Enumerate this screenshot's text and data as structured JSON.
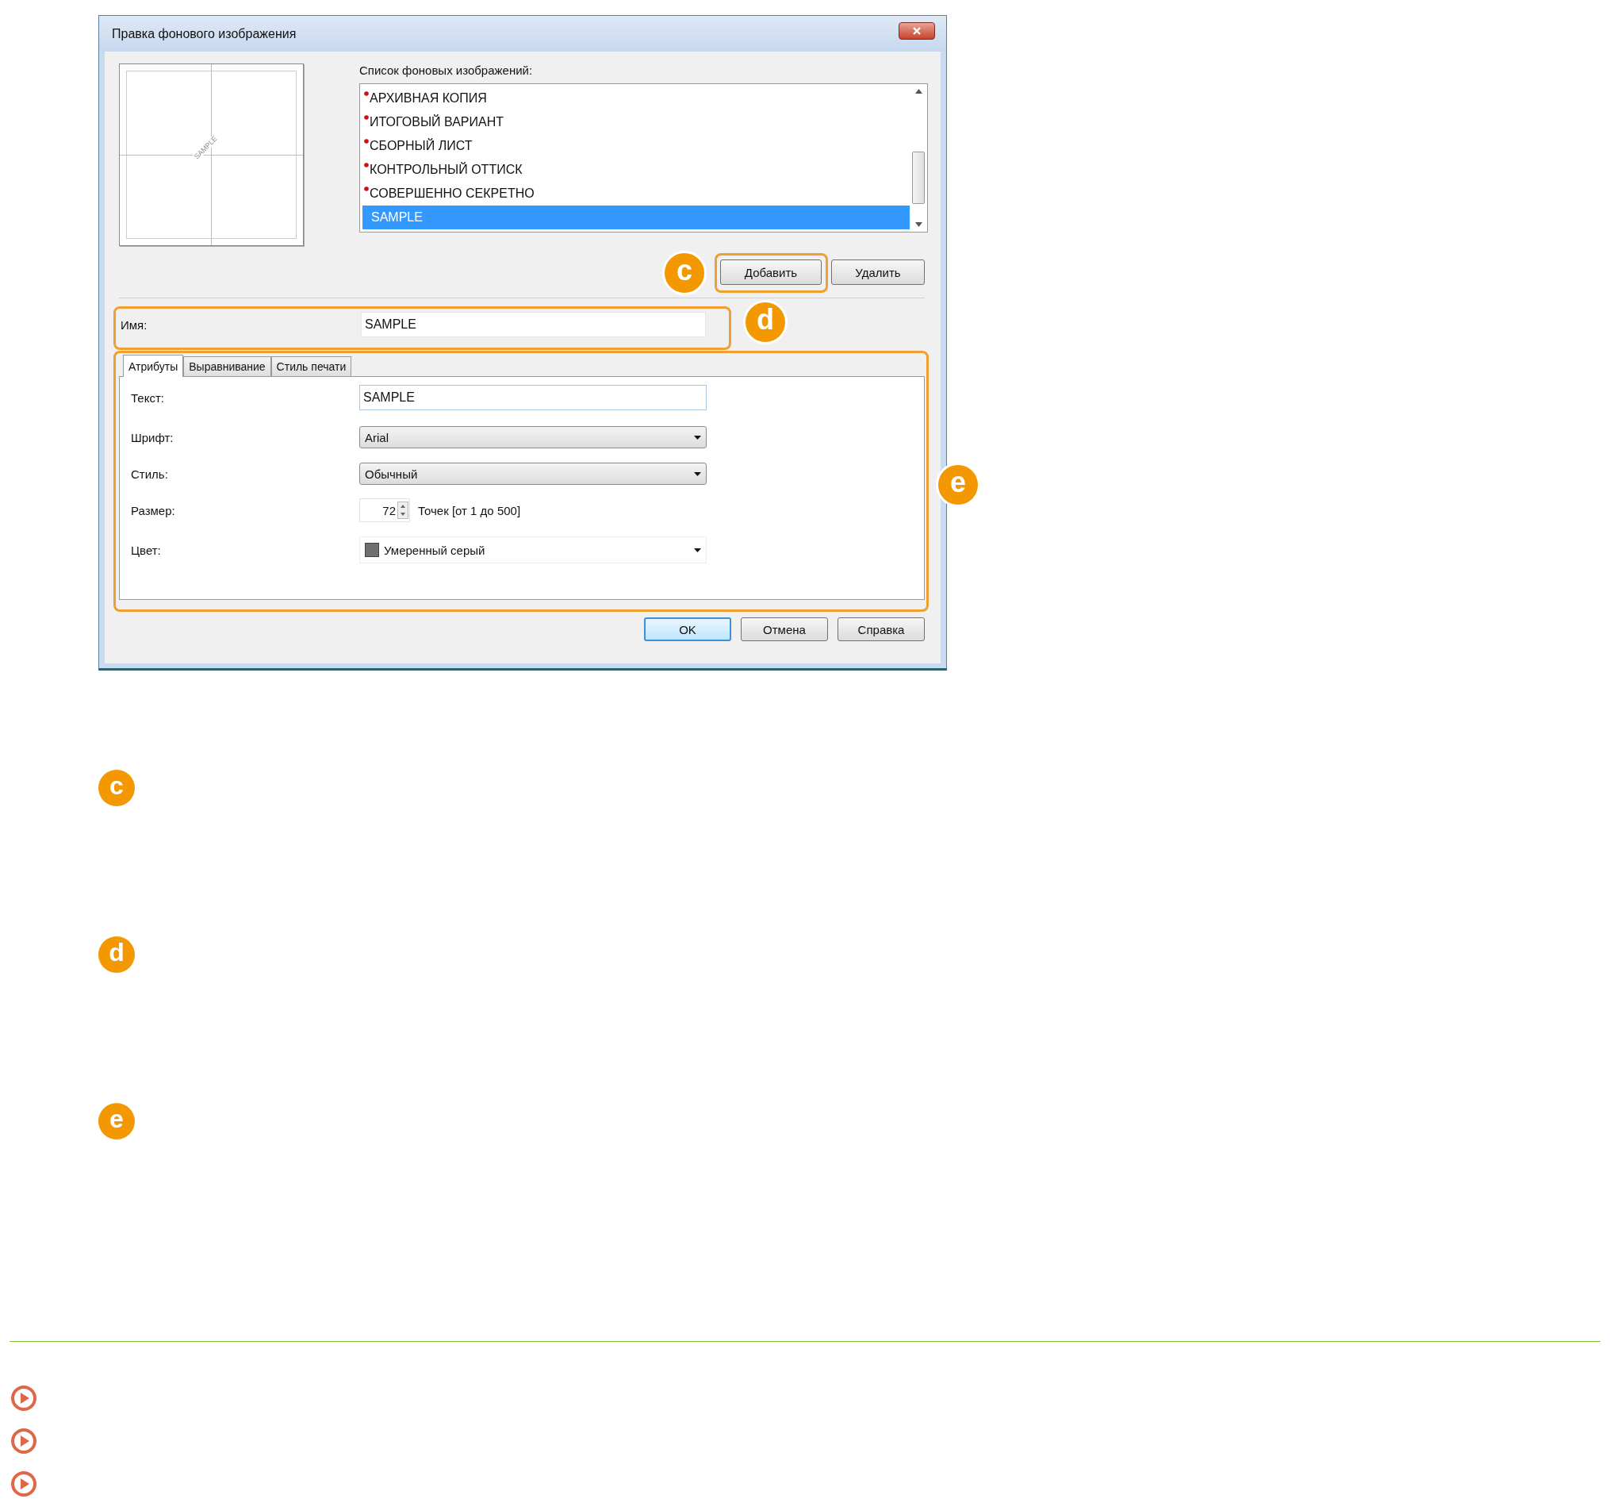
{
  "dialog": {
    "title": "Правка фонового изображения",
    "preview": {
      "sample_text": "SAMPLE"
    },
    "list_label": "Список фоновых изображений:",
    "list_items": [
      {
        "label": "АРХИВНАЯ КОПИЯ",
        "marked": true,
        "selected": false
      },
      {
        "label": "ИТОГОВЫЙ ВАРИАНТ",
        "marked": true,
        "selected": false
      },
      {
        "label": "СБОРНЫЙ ЛИСТ",
        "marked": true,
        "selected": false
      },
      {
        "label": "КОНТРОЛЬНЫЙ ОТТИСК",
        "marked": true,
        "selected": false
      },
      {
        "label": "СОВЕРШЕННО СЕКРЕТНО",
        "marked": true,
        "selected": false
      },
      {
        "label": "SAMPLE",
        "marked": false,
        "selected": true
      }
    ],
    "list_buttons": {
      "callout": "c",
      "items": [
        "Добавить",
        "Удалить"
      ]
    },
    "name": {
      "callout": "d",
      "label": "Имя:",
      "value": "SAMPLE"
    },
    "settings": {
      "callout": "e",
      "tabs": [
        {
          "label": "Атрибуты",
          "selected": true
        },
        {
          "label": "Выравнивание",
          "selected": false
        },
        {
          "label": "Стиль печати",
          "selected": false
        }
      ],
      "fields": [
        {
          "kind": "text",
          "label": "Текст:",
          "value": "SAMPLE"
        },
        {
          "kind": "dropdown",
          "label": "Шрифт:",
          "value": "Arial"
        },
        {
          "kind": "dropdown",
          "label": "Стиль:",
          "value": "Обычный"
        },
        {
          "kind": "spinner",
          "label": "Размер:",
          "value": "72",
          "note": "Точек [от 1 до 500]"
        },
        {
          "kind": "color",
          "label": "Цвет:",
          "value": "Умеренный серый"
        }
      ]
    },
    "buttons": [
      {
        "label": "OK",
        "default": true
      },
      {
        "label": "Отмена",
        "default": false
      },
      {
        "label": "Справка",
        "default": false
      }
    ]
  },
  "notes": [
    {
      "callout": "c"
    },
    {
      "callout": "d"
    },
    {
      "callout": "e"
    }
  ],
  "related_links": [
    {
      "kind": "arrow"
    },
    {
      "kind": "arrow"
    },
    {
      "kind": "arrow"
    }
  ]
}
